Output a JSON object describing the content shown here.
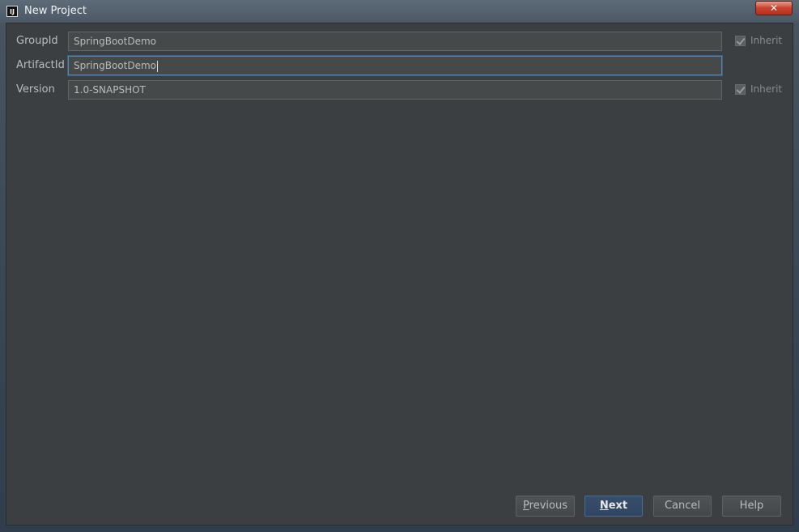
{
  "window": {
    "title": "New Project",
    "app_icon_text": "IJ",
    "close_glyph": "✕"
  },
  "form": {
    "group_id": {
      "label": "GroupId",
      "value": "SpringBootDemo",
      "inherit_label": "Inherit",
      "inherit_checked": true
    },
    "artifact_id": {
      "label": "ArtifactId",
      "value": "SpringBootDemo"
    },
    "version": {
      "label": "Version",
      "value": "1.0-SNAPSHOT",
      "inherit_label": "Inherit",
      "inherit_checked": true
    }
  },
  "buttons": {
    "previous": {
      "mnemonic": "P",
      "rest": "revious"
    },
    "next": {
      "mnemonic": "N",
      "rest": "ext"
    },
    "cancel": "Cancel",
    "help": "Help"
  },
  "colors": {
    "panel_bg": "#3c3f41",
    "focus_border": "#5a86ad",
    "default_button": "#2f4561"
  }
}
